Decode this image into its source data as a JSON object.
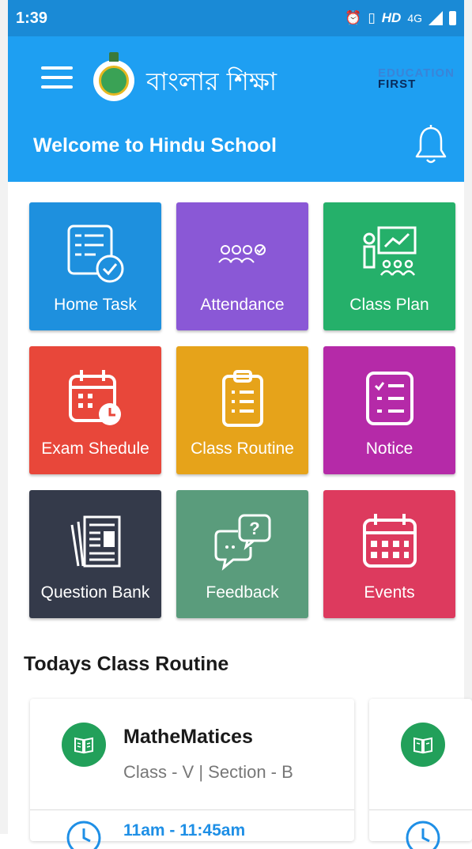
{
  "status": {
    "time": "1:39",
    "hd": "HD",
    "network": "4G"
  },
  "header": {
    "brand_title": "বাংলার শিক্ষা",
    "edu_line1": "EDUCATION",
    "edu_line2": "FIRST",
    "welcome": "Welcome to Hindu School"
  },
  "tiles": [
    {
      "label": "Home Task",
      "color": "#1e90de",
      "icon": "checklist-icon"
    },
    {
      "label": "Attendance",
      "color": "#8a58d6",
      "icon": "people-check-icon"
    },
    {
      "label": "Class Plan",
      "color": "#25b06a",
      "icon": "presentation-icon"
    },
    {
      "label": "Exam Shedule",
      "color": "#e8473a",
      "icon": "calendar-clock-icon"
    },
    {
      "label": "Class Routine",
      "color": "#e6a31a",
      "icon": "clipboard-icon"
    },
    {
      "label": "Notice",
      "color": "#b52aa8",
      "icon": "notice-list-icon"
    },
    {
      "label": "Question Bank",
      "color": "#343a4a",
      "icon": "newspaper-icon"
    },
    {
      "label": "Feedback",
      "color": "#5a9c7c",
      "icon": "chat-question-icon"
    },
    {
      "label": "Events",
      "color": "#dd3a5e",
      "icon": "calendar-icon"
    }
  ],
  "routine": {
    "title": "Todays Class Routine",
    "cards": [
      {
        "subject": "MatheMatices",
        "meta": "Class - V | Section - B",
        "time": "11am - 11:45am"
      },
      {
        "subject": "",
        "meta": "",
        "time": ""
      }
    ]
  },
  "colors": {
    "statusbar": "#1a8ad6",
    "appbar": "#1e9ff2",
    "accent_time": "#1e8fe6",
    "book_circle": "#22a05a"
  }
}
